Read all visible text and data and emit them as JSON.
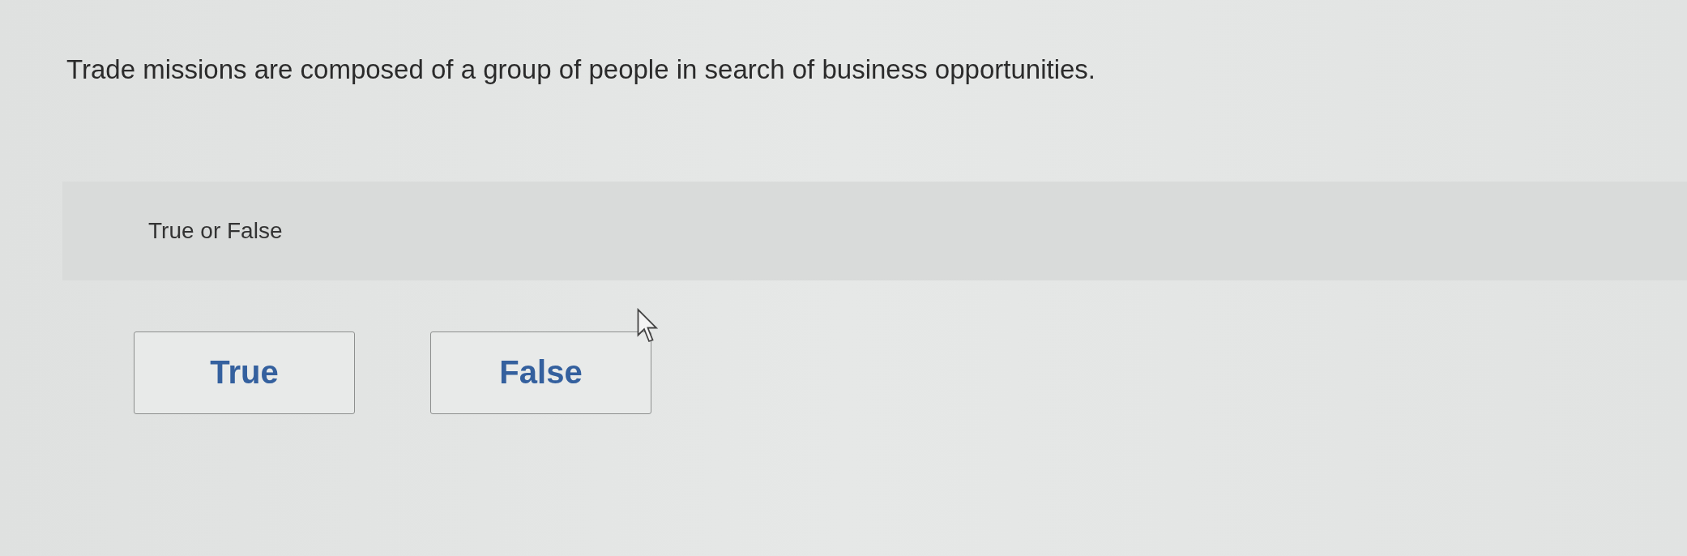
{
  "question": "Trade missions are composed of a group of people in search of business opportunities.",
  "prompt": "True or False",
  "options": [
    {
      "label": "True",
      "selected": false
    },
    {
      "label": "False",
      "selected": false
    }
  ]
}
